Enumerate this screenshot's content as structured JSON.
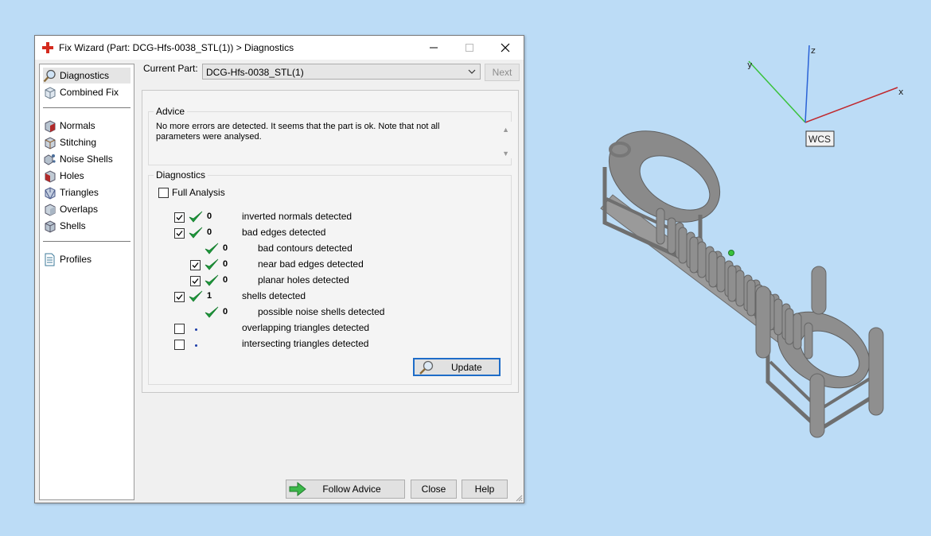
{
  "window": {
    "title": "Fix Wizard (Part: DCG-Hfs-0038_STL(1)) > Diagnostics",
    "controls": {
      "minimize": "minimize",
      "maximize": "maximize",
      "close": "close"
    }
  },
  "nav": {
    "top_items": [
      {
        "label": "Diagnostics",
        "icon": "magnifier-icon",
        "selected": true
      },
      {
        "label": "Combined Fix",
        "icon": "cube-icon"
      }
    ],
    "fix_items": [
      {
        "label": "Normals",
        "icon": "normals-cube-icon"
      },
      {
        "label": "Stitching",
        "icon": "stitching-cube-icon"
      },
      {
        "label": "Noise Shells",
        "icon": "noise-shells-icon"
      },
      {
        "label": "Holes",
        "icon": "holes-cube-icon"
      },
      {
        "label": "Triangles",
        "icon": "triangles-cube-icon"
      },
      {
        "label": "Overlaps",
        "icon": "overlaps-cube-icon"
      },
      {
        "label": "Shells",
        "icon": "shells-cube-icon"
      }
    ],
    "bottom_items": [
      {
        "label": "Profiles",
        "icon": "document-icon"
      }
    ]
  },
  "current_part": {
    "label": "Current Part:",
    "value": "DCG-Hfs-0038_STL(1)",
    "next_label": "Next"
  },
  "advice": {
    "title": "Advice",
    "text_line1": "No more errors are detected. It seems that the part is ok. Note that not all",
    "text_line2": "parameters were analysed."
  },
  "diagnostics": {
    "title": "Diagnostics",
    "full_analysis_label": "Full Analysis",
    "full_analysis_checked": false,
    "rows": [
      {
        "checkbox": true,
        "checked": true,
        "status": "ok",
        "count": "0",
        "label": "inverted normals detected",
        "indent": 0
      },
      {
        "checkbox": true,
        "checked": true,
        "status": "ok",
        "count": "0",
        "label": "bad edges detected",
        "indent": 0
      },
      {
        "checkbox": false,
        "checked": false,
        "status": "ok",
        "count": "0",
        "label": "bad contours detected",
        "indent": 1
      },
      {
        "checkbox": true,
        "checked": true,
        "status": "ok",
        "count": "0",
        "label": "near bad edges detected",
        "indent": 1
      },
      {
        "checkbox": true,
        "checked": true,
        "status": "ok",
        "count": "0",
        "label": "planar holes detected",
        "indent": 1
      },
      {
        "checkbox": true,
        "checked": true,
        "status": "ok",
        "count": "1",
        "label": "shells detected",
        "indent": 0
      },
      {
        "checkbox": false,
        "checked": false,
        "status": "ok",
        "count": "0",
        "label": "possible noise shells detected",
        "indent": 1
      },
      {
        "checkbox": true,
        "checked": false,
        "status": "none",
        "count": "",
        "label": "overlapping triangles detected",
        "indent": 0
      },
      {
        "checkbox": true,
        "checked": false,
        "status": "none",
        "count": "",
        "label": "intersecting triangles detected",
        "indent": 0
      }
    ],
    "update_label": "Update"
  },
  "footer": {
    "follow_advice": "Follow Advice",
    "close": "Close",
    "help": "Help"
  },
  "viewport": {
    "axes": {
      "x": "x",
      "y": "y",
      "z": "z"
    },
    "wcs_label": "WCS",
    "colors": {
      "x": "#c0282d",
      "y": "#39c23b",
      "z": "#2a62d6",
      "model": "#8c8c8c",
      "background": "#bcdcf6"
    }
  }
}
